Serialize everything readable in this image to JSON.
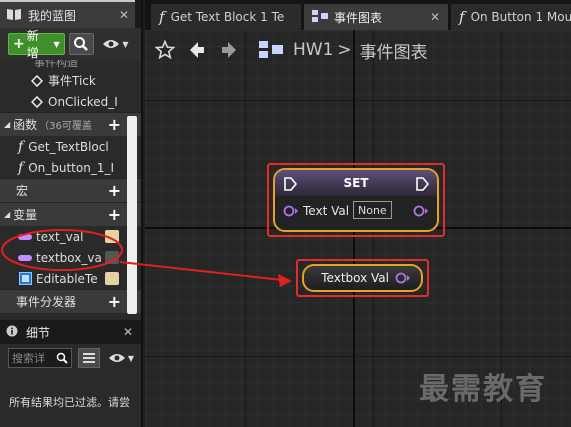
{
  "my_blueprint": {
    "tab_label": "我的蓝图",
    "new_button": "新增",
    "tree": {
      "cut_row": "事件构造",
      "event_tick": "事件Tick",
      "on_clicked": "OnClicked_I",
      "functions_label": "函数",
      "functions_count": "（36可覆盖",
      "func_items": [
        "Get_TextBlocl",
        "On_button_1_I"
      ],
      "macros_label": "宏",
      "variables_label": "变量",
      "var_items": [
        "text_val",
        "textbox_va",
        "EditableTe"
      ],
      "dispatchers_label": "事件分发器"
    }
  },
  "details": {
    "tab_label": "细节",
    "search_placeholder": "搜索详",
    "filter_text": "所有结果均已过滤。请尝"
  },
  "doc_tabs": [
    {
      "label": "Get Text Block 1 Te",
      "icon": "function-icon"
    },
    {
      "label": "事件图表",
      "icon": "graph-icon"
    },
    {
      "label": "On Button 1 Mou",
      "icon": "function-icon"
    }
  ],
  "graph": {
    "breadcrumb_root": "HW1",
    "breadcrumb_sep": ">",
    "breadcrumb_current": "事件图表",
    "set_node": {
      "title": "SET",
      "pin_label": "Text Val",
      "pin_value": "None"
    },
    "get_node": {
      "label": "Textbox Val"
    },
    "watermark": "最需教育"
  },
  "colors": {
    "highlight_red": "#e02d2d",
    "node_border_orange": "#e6a12a",
    "string_pin": "#b070e8",
    "new_button_green": "#3f8f2a"
  }
}
